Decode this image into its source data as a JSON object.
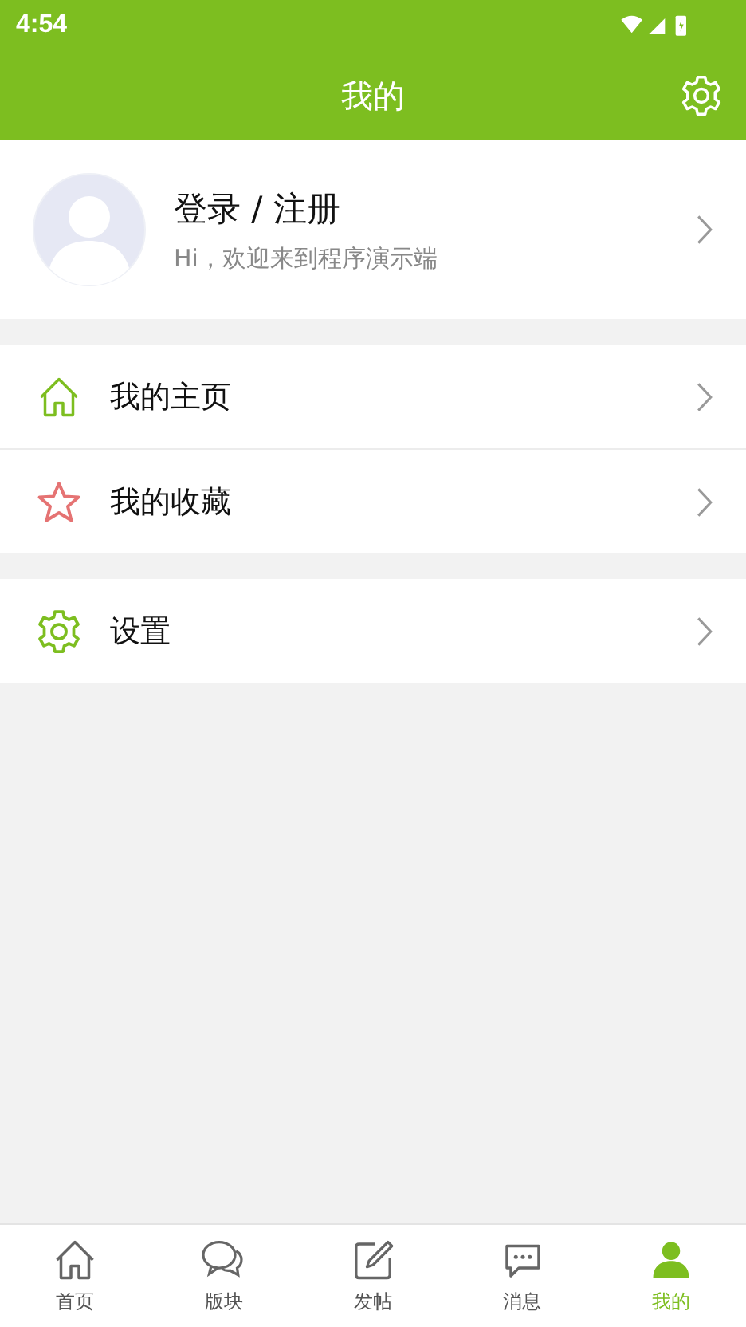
{
  "status_bar": {
    "time": "4:54"
  },
  "header": {
    "title": "我的"
  },
  "profile": {
    "name": "登录 / 注册",
    "greeting": "Hi，欢迎来到程序演示端"
  },
  "menu_groups": [
    [
      {
        "label": "我的主页"
      },
      {
        "label": "我的收藏"
      }
    ],
    [
      {
        "label": "设置"
      }
    ]
  ],
  "tab_bar": [
    {
      "label": "首页",
      "selected": false
    },
    {
      "label": "版块",
      "selected": false
    },
    {
      "label": "发帖",
      "selected": false
    },
    {
      "label": "消息",
      "selected": false
    },
    {
      "label": "我的",
      "selected": true
    }
  ]
}
